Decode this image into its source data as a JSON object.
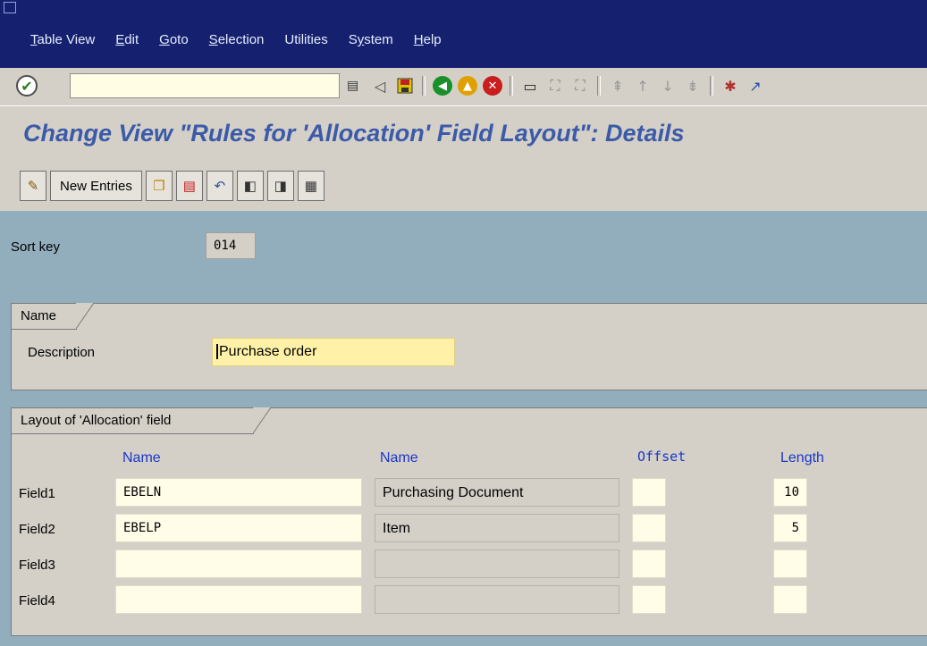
{
  "menu": {
    "items": [
      "Table View",
      "Edit",
      "Goto",
      "Selection",
      "Utilities",
      "System",
      "Help"
    ]
  },
  "toolbar": {
    "command_field": "",
    "icons": [
      "save-icon",
      "back-icon",
      "exit-icon",
      "cancel-icon",
      "print-icon",
      "find-icon",
      "find-next-icon",
      "first-page-icon",
      "previous-page-icon",
      "next-page-icon",
      "last-page-icon",
      "create-session-icon",
      "shortcut-icon"
    ]
  },
  "title": "Change View \"Rules for 'Allocation' Field Layout\": Details",
  "app_toolbar": {
    "new_entries": "New Entries",
    "icons": [
      "display-change-icon",
      "copy-icon",
      "delete-icon",
      "undo-change-icon",
      "previous-entry-icon",
      "next-entry-icon",
      "select-all-icon"
    ]
  },
  "sort_key": {
    "label": "Sort key",
    "value": "014"
  },
  "name_group": {
    "tab": "Name",
    "description_label": "Description",
    "description_value": "Purchase order"
  },
  "layout_group": {
    "tab": "Layout of 'Allocation' field",
    "headers": {
      "name1": "Name",
      "name2": "Name",
      "offset": "Offset",
      "length": "Length"
    },
    "rows": [
      {
        "label": "Field1",
        "field": "EBELN",
        "desc": "Purchasing Document",
        "offset": "",
        "length": "10"
      },
      {
        "label": "Field2",
        "field": "EBELP",
        "desc": "Item",
        "offset": "",
        "length": "5"
      },
      {
        "label": "Field3",
        "field": "",
        "desc": "",
        "offset": "",
        "length": ""
      },
      {
        "label": "Field4",
        "field": "",
        "desc": "",
        "offset": "",
        "length": ""
      }
    ]
  },
  "colors": {
    "menubar": "#15216e",
    "workarea": "#92aebd",
    "title": "#3b5aa8",
    "input_highlight": "#fff2a8"
  }
}
